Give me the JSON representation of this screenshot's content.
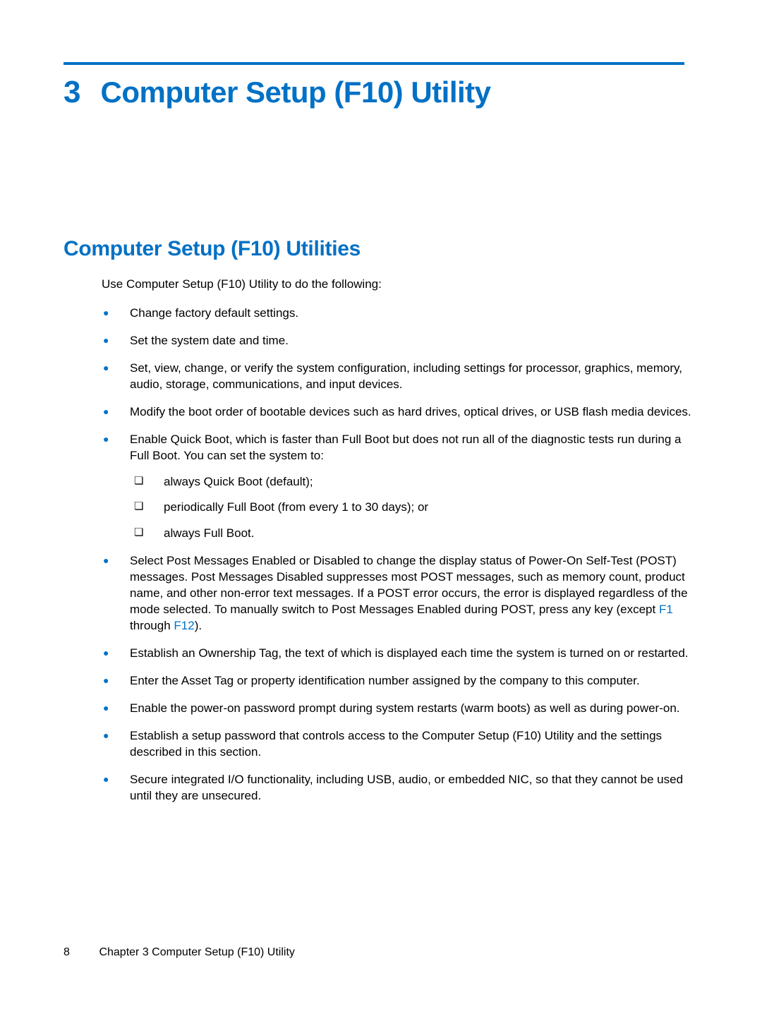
{
  "chapter": {
    "number": "3",
    "title": "Computer Setup (F10) Utility"
  },
  "section_heading": "Computer Setup (F10) Utilities",
  "intro": "Use Computer Setup (F10) Utility to do the following:",
  "bullets": [
    "Change factory default settings.",
    "Set the system date and time.",
    "Set, view, change, or verify the system configuration, including settings for processor, graphics, memory, audio, storage, communications, and input devices.",
    "Modify the boot order of bootable devices such as hard drives, optical drives, or USB flash media devices.",
    "Enable Quick Boot, which is faster than Full Boot but does not run all of the diagnostic tests run during a Full Boot. You can set the system to:"
  ],
  "sublist": [
    "always Quick Boot (default);",
    "periodically Full Boot (from every 1 to 30 days); or",
    "always Full Boot."
  ],
  "post_item": {
    "pre": "Select Post Messages Enabled or Disabled to change the display status of Power-On Self-Test (POST) messages. Post Messages Disabled suppresses most POST messages, such as memory count, product name, and other non-error text messages. If a POST error occurs, the error is displayed regardless of the mode selected. To manually switch to Post Messages Enabled during POST, press any key (except ",
    "key1": "F1",
    "mid": " through ",
    "key2": "F12",
    "post": ")."
  },
  "bullets_after": [
    "Establish an Ownership Tag, the text of which is displayed each time the system is turned on or restarted.",
    "Enter the Asset Tag or property identification number assigned by the company to this computer.",
    "Enable the power-on password prompt during system restarts (warm boots) as well as during power-on.",
    "Establish a setup password that controls access to the Computer Setup (F10) Utility and the settings described in this section.",
    "Secure integrated I/O functionality, including USB, audio, or embedded NIC, so that they cannot be used until they are unsecured."
  ],
  "footer": {
    "page": "8",
    "text": "Chapter 3   Computer Setup (F10) Utility"
  }
}
